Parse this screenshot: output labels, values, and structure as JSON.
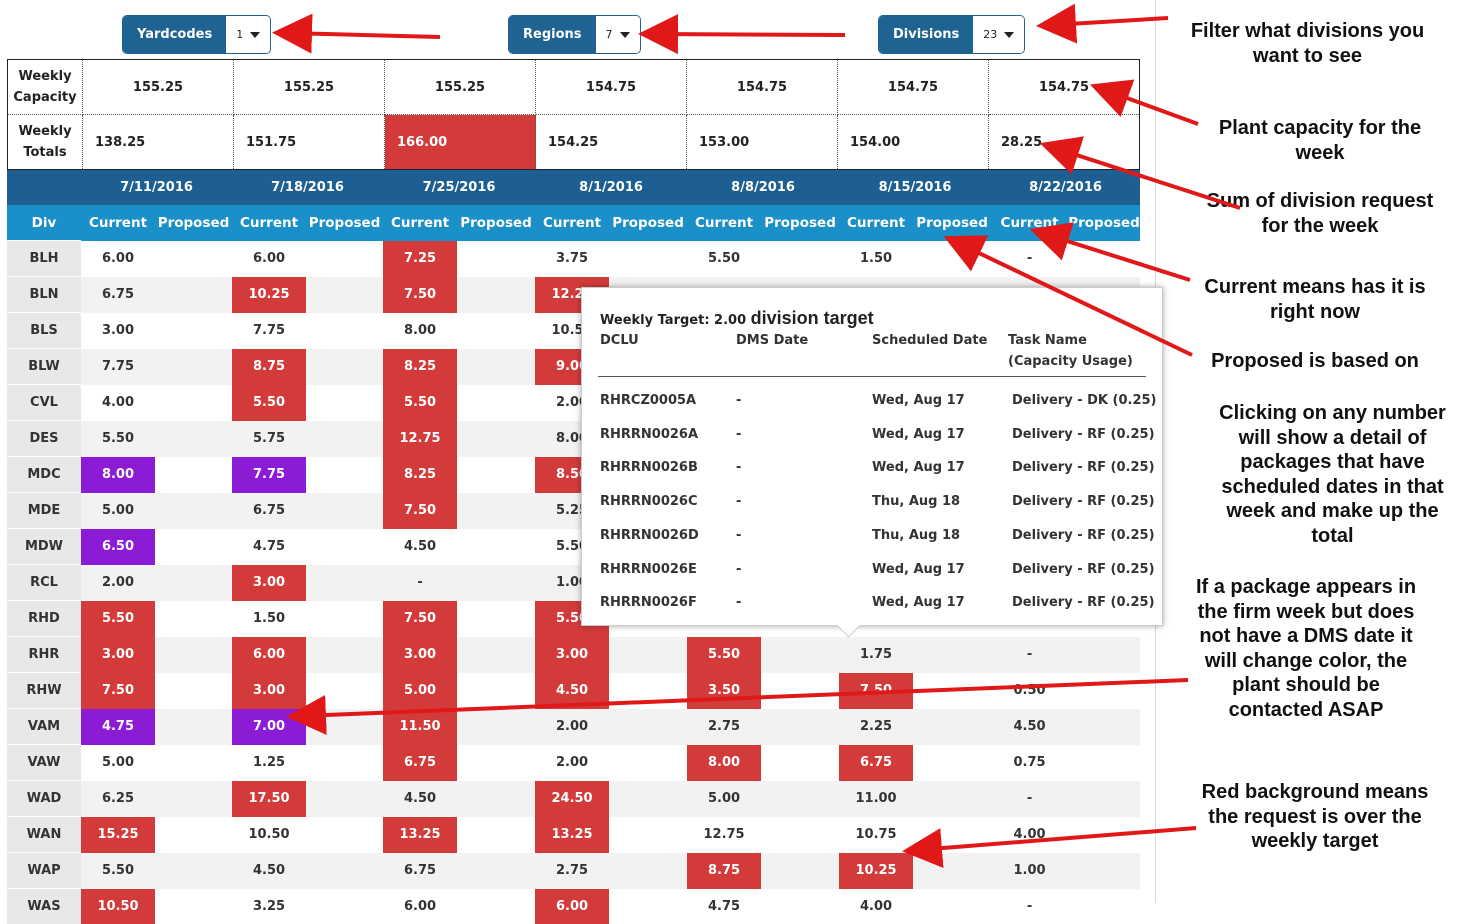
{
  "filters": [
    {
      "label": "Yardcodes",
      "value": "1"
    },
    {
      "label": "Regions",
      "value": "7"
    },
    {
      "label": "Divisions",
      "value": "23"
    }
  ],
  "summary": {
    "capacity_label": "Weekly Capacity",
    "totals_label": "Weekly Totals",
    "capacity": [
      "155.25",
      "155.25",
      "155.25",
      "154.75",
      "154.75",
      "154.75",
      "154.75"
    ],
    "totals": [
      "138.25",
      "151.75",
      "166.00",
      "154.25",
      "153.00",
      "154.00",
      "28.25"
    ]
  },
  "grid": {
    "weeks": [
      "7/11/2016",
      "7/18/2016",
      "7/25/2016",
      "8/1/2016",
      "8/8/2016",
      "8/15/2016",
      "8/22/2016"
    ],
    "div_header": "Div",
    "current_label": "Current",
    "proposed_label": "Proposed",
    "rows": [
      {
        "div": "BLH",
        "current": [
          "6.00",
          "6.00",
          "7.25",
          "3.75",
          "5.50",
          "1.50",
          "-"
        ]
      },
      {
        "div": "BLN",
        "current": [
          "6.75",
          "10.25",
          "7.50",
          "12.25",
          "",
          "",
          ""
        ]
      },
      {
        "div": "BLS",
        "current": [
          "3.00",
          "7.75",
          "8.00",
          "10.50",
          "",
          "",
          ""
        ]
      },
      {
        "div": "BLW",
        "current": [
          "7.75",
          "8.75",
          "8.25",
          "9.00",
          "",
          "",
          ""
        ]
      },
      {
        "div": "CVL",
        "current": [
          "4.00",
          "5.50",
          "5.50",
          "2.00",
          "",
          "",
          ""
        ]
      },
      {
        "div": "DES",
        "current": [
          "5.50",
          "5.75",
          "12.75",
          "8.00",
          "",
          "",
          ""
        ]
      },
      {
        "div": "MDC",
        "current": [
          "8.00",
          "7.75",
          "8.25",
          "8.50",
          "",
          "",
          ""
        ]
      },
      {
        "div": "MDE",
        "current": [
          "5.00",
          "6.75",
          "7.50",
          "5.25",
          "",
          "",
          ""
        ]
      },
      {
        "div": "MDW",
        "current": [
          "6.50",
          "4.75",
          "4.50",
          "5.50",
          "",
          "",
          ""
        ]
      },
      {
        "div": "RCL",
        "current": [
          "2.00",
          "3.00",
          "-",
          "1.00",
          "",
          "",
          ""
        ]
      },
      {
        "div": "RHD",
        "current": [
          "5.50",
          "1.50",
          "7.50",
          "5.50",
          "",
          "",
          ""
        ]
      },
      {
        "div": "RHR",
        "current": [
          "3.00",
          "6.00",
          "3.00",
          "3.00",
          "5.50",
          "1.75",
          "-"
        ]
      },
      {
        "div": "RHW",
        "current": [
          "7.50",
          "3.00",
          "5.00",
          "4.50",
          "3.50",
          "7.50",
          "0.50"
        ]
      },
      {
        "div": "VAM",
        "current": [
          "4.75",
          "7.00",
          "11.50",
          "2.00",
          "2.75",
          "2.25",
          "4.50"
        ]
      },
      {
        "div": "VAW",
        "current": [
          "5.00",
          "1.25",
          "6.75",
          "2.00",
          "8.00",
          "6.75",
          "0.75"
        ]
      },
      {
        "div": "WAD",
        "current": [
          "6.25",
          "17.50",
          "4.50",
          "24.50",
          "5.00",
          "11.00",
          "-"
        ]
      },
      {
        "div": "WAN",
        "current": [
          "15.25",
          "10.50",
          "13.25",
          "13.25",
          "12.75",
          "10.75",
          "4.00"
        ]
      },
      {
        "div": "WAP",
        "current": [
          "5.50",
          "4.50",
          "6.75",
          "2.75",
          "8.75",
          "10.25",
          "1.00"
        ]
      },
      {
        "div": "WAS",
        "current": [
          "10.50",
          "3.25",
          "6.00",
          "6.00",
          "4.75",
          "4.00",
          "-"
        ]
      }
    ]
  },
  "popup": {
    "weekly_target": "Weekly Target: 2.00",
    "division_target": "division target",
    "headers": {
      "dclu": "DCLU",
      "dms": "DMS Date",
      "scheduled": "Scheduled Date",
      "task": "Task Name",
      "usage": "(Capacity Usage)"
    },
    "rows": [
      {
        "dclu": "RHRCZ0005A",
        "dms": "-",
        "scheduled": "Wed, Aug 17",
        "task": "Delivery - DK (0.25)"
      },
      {
        "dclu": "RHRRN0026A",
        "dms": "-",
        "scheduled": "Wed, Aug 17",
        "task": "Delivery - RF (0.25)"
      },
      {
        "dclu": "RHRRN0026B",
        "dms": "-",
        "scheduled": "Wed, Aug 17",
        "task": "Delivery - RF (0.25)"
      },
      {
        "dclu": "RHRRN0026C",
        "dms": "-",
        "scheduled": "Thu, Aug 18",
        "task": "Delivery - RF (0.25)"
      },
      {
        "dclu": "RHRRN0026D",
        "dms": "-",
        "scheduled": "Thu, Aug 18",
        "task": "Delivery - RF (0.25)"
      },
      {
        "dclu": "RHRRN0026E",
        "dms": "-",
        "scheduled": "Wed, Aug 17",
        "task": "Delivery - RF (0.25)"
      },
      {
        "dclu": "RHRRN0026F",
        "dms": "-",
        "scheduled": "Wed, Aug 17",
        "task": "Delivery - RF (0.25)"
      }
    ]
  },
  "annotations": [
    "Filter what divisions you want to see",
    "Plant capacity for the week",
    "Sum of division request for the week",
    "Current means has it is right now",
    "Proposed is based on",
    "Clicking on any number will show a detail of packages that have scheduled dates in that week and make up the total",
    "If a package appears in the firm week but does not have a DMS date it will change color, the plant should be contacted ASAP",
    "Red background means the request is over the weekly target"
  ],
  "colors": {
    "header_dark": "#1e5f93",
    "header_light": "#1b8fc7",
    "over_target": "#d33b3b",
    "no_dms": "#8c1bd6",
    "arrow": "#e01818"
  }
}
